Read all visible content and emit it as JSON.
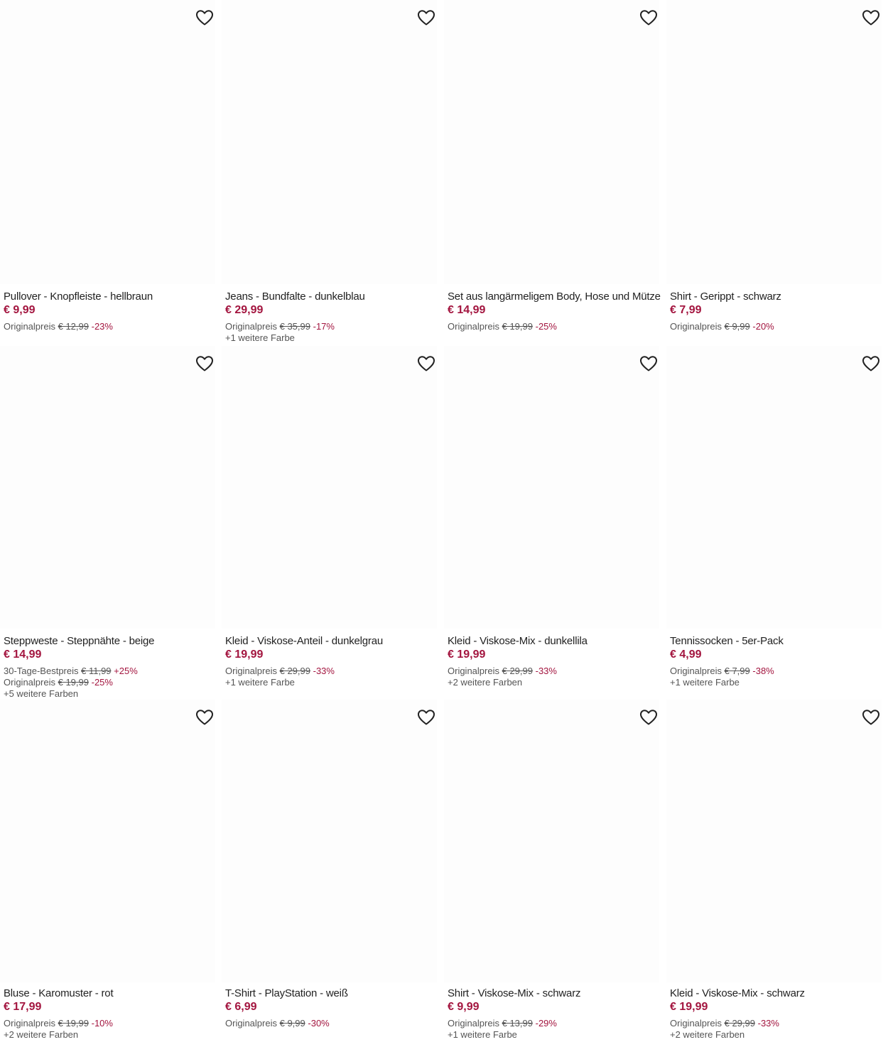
{
  "colors": {
    "price": "#a3153f",
    "discount": "#a3153f",
    "text": "#222222",
    "muted": "#555555"
  },
  "icons": {
    "wishlist": "heart-outline-icon"
  },
  "products": [
    {
      "title": "Pullover - Knopfleiste - hellbraun",
      "price": "€ 9,99",
      "lines": [
        {
          "label": "Originalpreis",
          "old": "€ 12,99",
          "diff": "-23%"
        }
      ],
      "more": ""
    },
    {
      "title": "Jeans - Bundfalte - dunkelblau",
      "price": "€ 29,99",
      "lines": [
        {
          "label": "Originalpreis",
          "old": "€ 35,99",
          "diff": "-17%"
        }
      ],
      "more": "+1 weitere Farbe"
    },
    {
      "title": "Set aus langärmeligem Body, Hose und Mütze",
      "price": "€ 14,99",
      "lines": [
        {
          "label": "Originalpreis",
          "old": "€ 19,99",
          "diff": "-25%"
        }
      ],
      "more": ""
    },
    {
      "title": "Shirt - Gerippt - schwarz",
      "price": "€ 7,99",
      "lines": [
        {
          "label": "Originalpreis",
          "old": "€ 9,99",
          "diff": "-20%"
        }
      ],
      "more": ""
    },
    {
      "title": "Steppweste - Steppnähte - beige",
      "price": "€ 14,99",
      "lines": [
        {
          "label": "30-Tage-Bestpreis",
          "old": "€ 11,99",
          "diff": "+25%"
        },
        {
          "label": "Originalpreis",
          "old": "€ 19,99",
          "diff": "-25%"
        }
      ],
      "more": "+5 weitere Farben"
    },
    {
      "title": "Kleid - Viskose-Anteil - dunkelgrau",
      "price": "€ 19,99",
      "lines": [
        {
          "label": "Originalpreis",
          "old": "€ 29,99",
          "diff": "-33%"
        }
      ],
      "more": "+1 weitere Farbe"
    },
    {
      "title": "Kleid - Viskose-Mix - dunkellila",
      "price": "€ 19,99",
      "lines": [
        {
          "label": "Originalpreis",
          "old": "€ 29,99",
          "diff": "-33%"
        }
      ],
      "more": "+2 weitere Farben"
    },
    {
      "title": "Tennissocken - 5er-Pack",
      "price": "€ 4,99",
      "lines": [
        {
          "label": "Originalpreis",
          "old": "€ 7,99",
          "diff": "-38%"
        }
      ],
      "more": "+1 weitere Farbe"
    },
    {
      "title": "Bluse - Karomuster - rot",
      "price": "€ 17,99",
      "lines": [
        {
          "label": "Originalpreis",
          "old": "€ 19,99",
          "diff": "-10%"
        }
      ],
      "more": "+2 weitere Farben"
    },
    {
      "title": "T-Shirt - PlayStation - weiß",
      "price": "€ 6,99",
      "lines": [
        {
          "label": "Originalpreis",
          "old": "€ 9,99",
          "diff": "-30%"
        }
      ],
      "more": ""
    },
    {
      "title": "Shirt - Viskose-Mix - schwarz",
      "price": "€ 9,99",
      "lines": [
        {
          "label": "Originalpreis",
          "old": "€ 13,99",
          "diff": "-29%"
        }
      ],
      "more": "+1 weitere Farbe"
    },
    {
      "title": "Kleid - Viskose-Mix - schwarz",
      "price": "€ 19,99",
      "lines": [
        {
          "label": "Originalpreis",
          "old": "€ 29,99",
          "diff": "-33%"
        }
      ],
      "more": "+2 weitere Farben"
    }
  ]
}
